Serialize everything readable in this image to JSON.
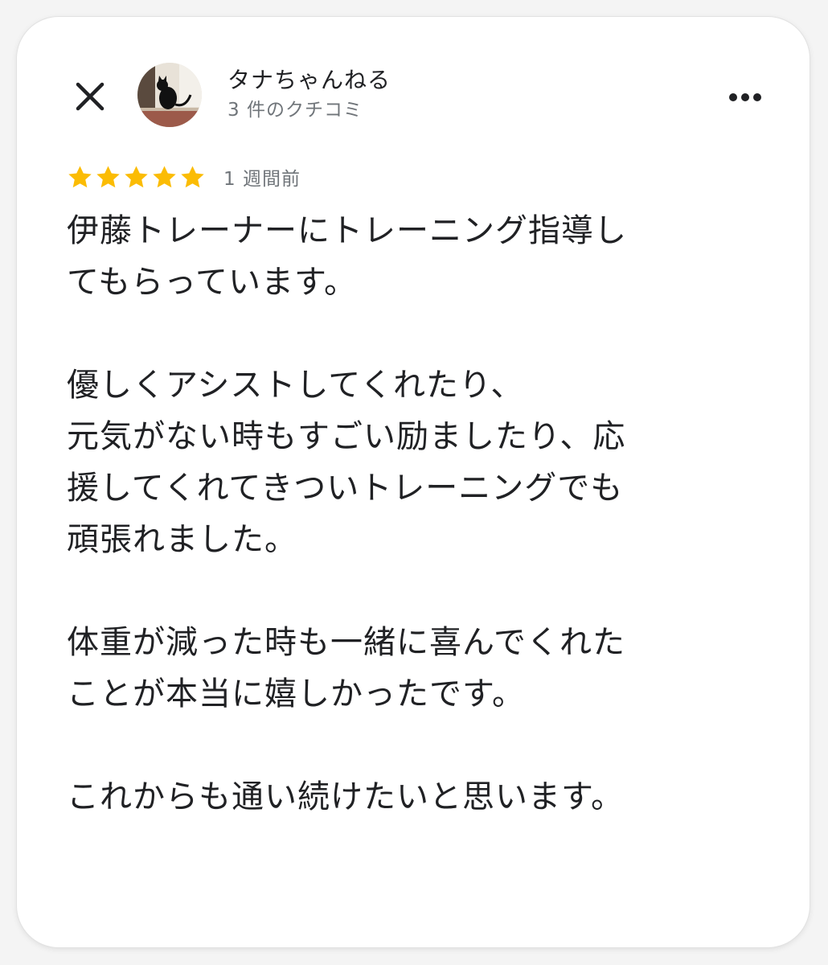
{
  "header": {
    "close_icon": "close-icon",
    "more_icon": "more-horiz-icon",
    "reviewer_name": "タナちゃんねる",
    "reviewer_review_count": "3 件のクチコミ"
  },
  "rating": {
    "stars": 5,
    "max_stars": 5,
    "star_color": "#fbbc04",
    "relative_time": "1 週間前"
  },
  "review": {
    "paragraphs": [
      {
        "lines": [
          "伊藤トレーナーにトレーニング指導し",
          "てもらっています。"
        ]
      },
      {
        "lines": [
          "優しくアシストしてくれたり、",
          "元気がない時もすごい励ましたり、応",
          "援してくれてきついトレーニングでも",
          "頑張れました。"
        ]
      },
      {
        "lines": [
          "体重が減った時も一緒に喜んでくれた",
          "ことが本当に嬉しかったです。"
        ]
      },
      {
        "lines": [
          "これからも通い続けたいと思います。"
        ]
      }
    ]
  }
}
